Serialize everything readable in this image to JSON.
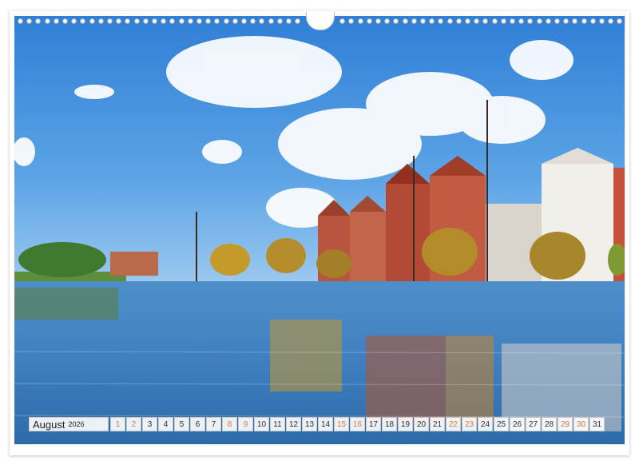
{
  "calendar": {
    "month": "August",
    "year": "2026",
    "days": [
      "1",
      "2",
      "3",
      "4",
      "5",
      "6",
      "7",
      "8",
      "9",
      "10",
      "11",
      "12",
      "13",
      "14",
      "15",
      "16",
      "17",
      "18",
      "19",
      "20",
      "21",
      "22",
      "23",
      "24",
      "25",
      "26",
      "27",
      "28",
      "29",
      "30",
      "31"
    ],
    "weekend_days": [
      "1",
      "2",
      "8",
      "9",
      "15",
      "16",
      "22",
      "23",
      "29",
      "30"
    ],
    "weekend_color": "#e07b3c"
  },
  "photo": {
    "subject": "harbour-waterfront-with-tall-ship-and-brick-gabled-houses"
  }
}
